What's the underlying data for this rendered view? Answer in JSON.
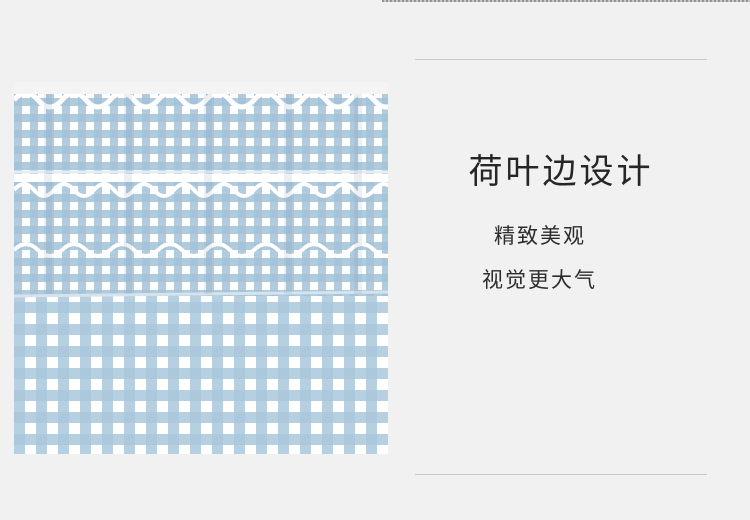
{
  "headline": "荷叶边设计",
  "features": [
    "精致美观",
    "视觉更大气"
  ],
  "photo": {
    "subject": "ruffle-edge-gingham-fabric",
    "colors": {
      "gingham": "#9fc0d8",
      "base": "#ffffff",
      "backdrop": "#f1f1f1"
    }
  }
}
